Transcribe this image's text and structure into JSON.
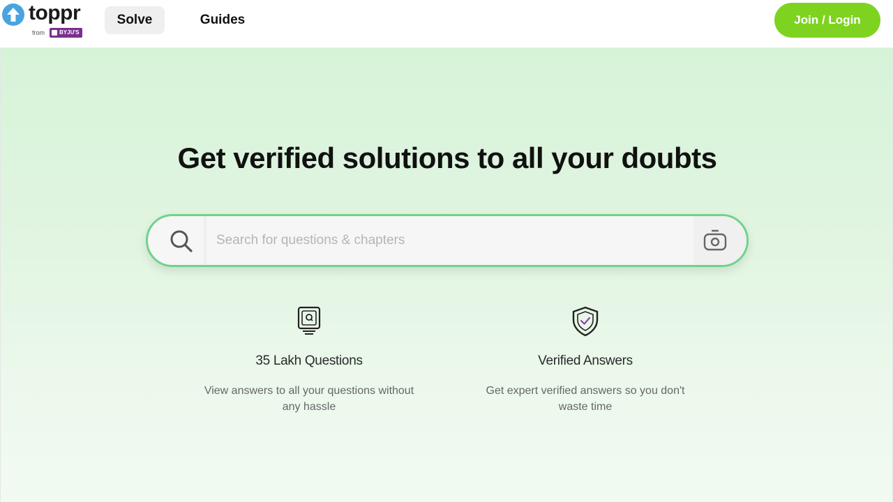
{
  "header": {
    "logo": {
      "word": "toppr",
      "from": "from",
      "brand": "BYJU'S"
    },
    "tabs": [
      {
        "label": "Solve",
        "active": true
      },
      {
        "label": "Guides",
        "active": false
      }
    ],
    "login_label": "Join / Login"
  },
  "hero": {
    "title": "Get verified solutions to all your doubts",
    "search": {
      "placeholder": "Search for questions & chapters",
      "value": ""
    },
    "features": [
      {
        "icon": "question-book-icon",
        "title": "35 Lakh Questions",
        "description": "View answers to all your questions without any hassle"
      },
      {
        "icon": "verified-shield-icon",
        "title": "Verified Answers",
        "description": "Get expert verified answers so you don't waste time"
      }
    ]
  },
  "colors": {
    "accent_green": "#7ed321",
    "search_border": "#6fd38a",
    "hero_bg": "#d6f3d8",
    "byjus_purple": "#7b2f8e"
  }
}
